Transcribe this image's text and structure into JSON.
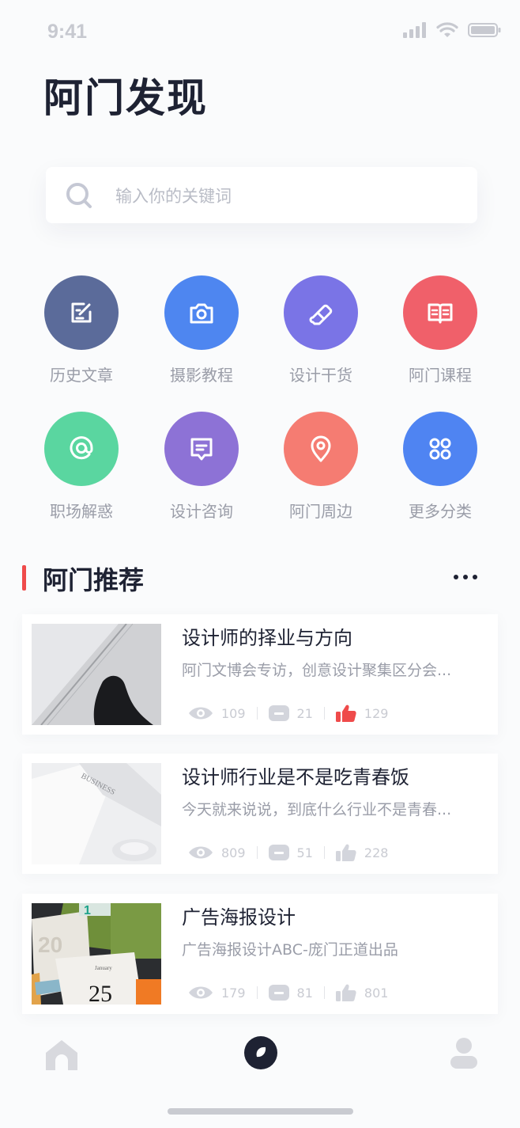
{
  "status": {
    "time": "9:41"
  },
  "page": {
    "title": "阿门发现"
  },
  "search": {
    "placeholder": "输入你的关键词"
  },
  "categories": [
    {
      "label": "历史文章",
      "color": "#5b6b9a",
      "icon": "edit-doc-icon"
    },
    {
      "label": "摄影教程",
      "color": "#4e86f0",
      "icon": "camera-icon"
    },
    {
      "label": "设计干货",
      "color": "#7a74e6",
      "icon": "eraser-icon"
    },
    {
      "label": "阿门课程",
      "color": "#f0606a",
      "icon": "book-icon"
    },
    {
      "label": "职场解惑",
      "color": "#5ad6a0",
      "icon": "at-icon"
    },
    {
      "label": "设计咨询",
      "color": "#8d72d6",
      "icon": "chat-icon"
    },
    {
      "label": "阿门周边",
      "color": "#f57c72",
      "icon": "location-pin-icon"
    },
    {
      "label": "更多分类",
      "color": "#4f84f2",
      "icon": "grid-apps-icon"
    }
  ],
  "section": {
    "title": "阿门推荐"
  },
  "articles": [
    {
      "title": "设计师的择业与方向",
      "desc": "阿门文博会专访，创意设计聚集区分会...",
      "views": "109",
      "comments": "21",
      "likes": "129",
      "liked": true
    },
    {
      "title": "设计师行业是不是吃青春饭",
      "desc": "今天就来说说，到底什么行业不是青春...",
      "views": "809",
      "comments": "51",
      "likes": "228",
      "liked": false
    },
    {
      "title": "广告海报设计",
      "desc": "广告海报设计ABC-庞门正道出品",
      "views": "179",
      "comments": "81",
      "likes": "801",
      "liked": false
    }
  ],
  "thumb_text": {
    "business": "BUSINESS",
    "month": "January",
    "day": "25",
    "top": "1",
    "stack": "20"
  },
  "colors": {
    "accent": "#ef4b4b",
    "dark": "#1e2233",
    "muted": "#9a9da8"
  }
}
